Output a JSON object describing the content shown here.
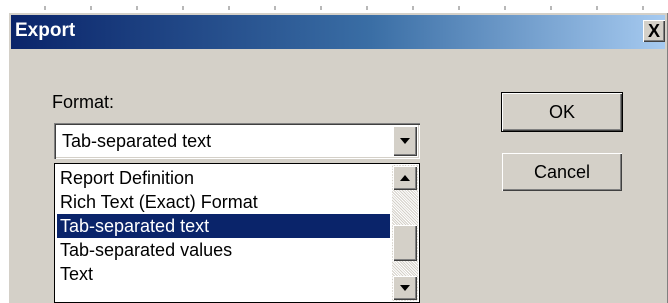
{
  "dialog": {
    "title": "Export",
    "close_glyph": "X",
    "format_label": "Format:",
    "selected_format": "Tab-separated text",
    "format_options": [
      "Report Definition",
      "Rich Text (Exact) Format",
      "Tab-separated text",
      "Tab-separated values",
      "Text"
    ],
    "highlighted_option": "Tab-separated text",
    "ok_label": "OK",
    "cancel_label": "Cancel"
  },
  "icons": {
    "close": "close-icon",
    "combo_arrow": "chevron-down-icon",
    "scroll_up": "scroll-up-arrow-icon",
    "scroll_down": "scroll-down-arrow-icon"
  },
  "colors": {
    "title_bar_start": "#0a246a",
    "title_bar_end": "#a6caf0",
    "selection": "#0a246a",
    "dialog_face": "#d4d0c8"
  }
}
